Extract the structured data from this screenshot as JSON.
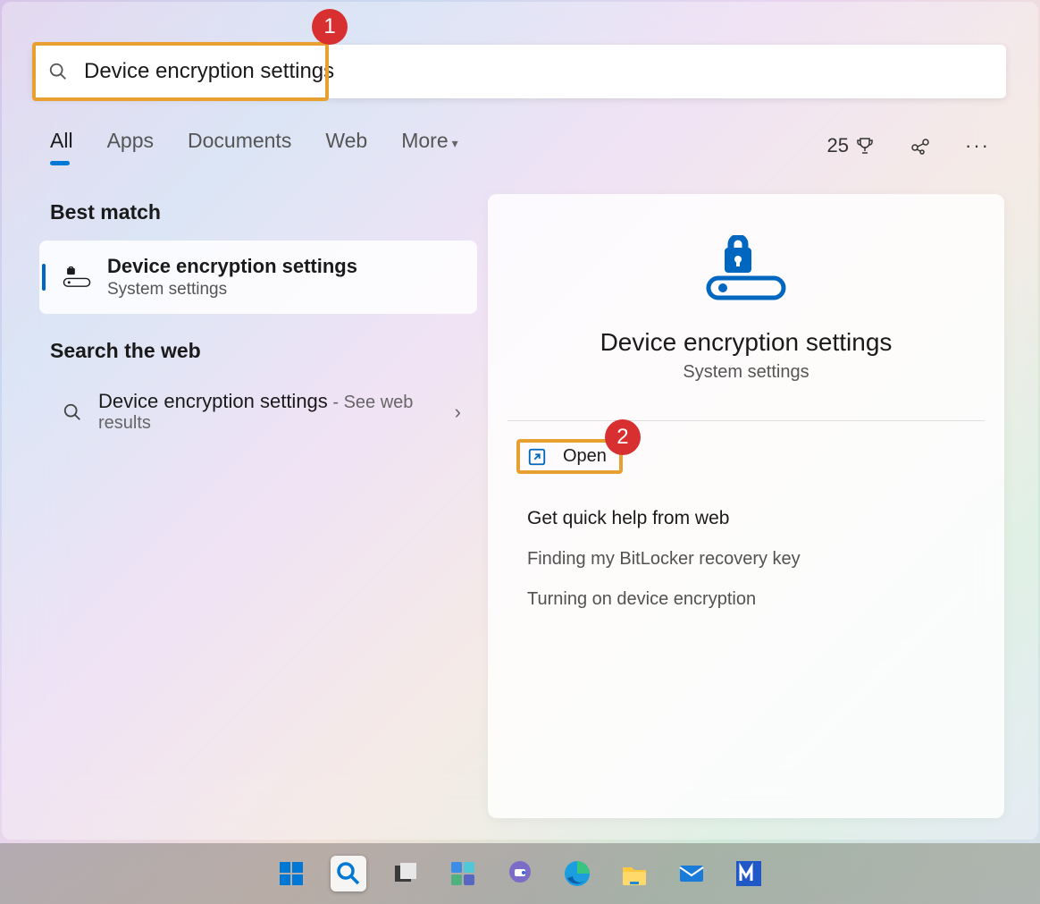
{
  "search": {
    "query": "Device encryption settings",
    "callout_1": "1"
  },
  "tabs": {
    "all": "All",
    "apps": "Apps",
    "documents": "Documents",
    "web": "Web",
    "more": "More"
  },
  "rewards_count": "25",
  "sections": {
    "best_match": "Best match",
    "search_web": "Search the web"
  },
  "best_match_result": {
    "title": "Device encryption settings",
    "subtitle": "System settings"
  },
  "web_result": {
    "title": "Device encryption settings",
    "suffix": " - See web results"
  },
  "detail_panel": {
    "title": "Device encryption settings",
    "subtitle": "System settings",
    "open_label": "Open",
    "callout_2": "2",
    "quick_help_heading": "Get quick help from web",
    "quick_links": {
      "link1": "Finding my BitLocker recovery key",
      "link2": "Turning on device encryption"
    }
  }
}
